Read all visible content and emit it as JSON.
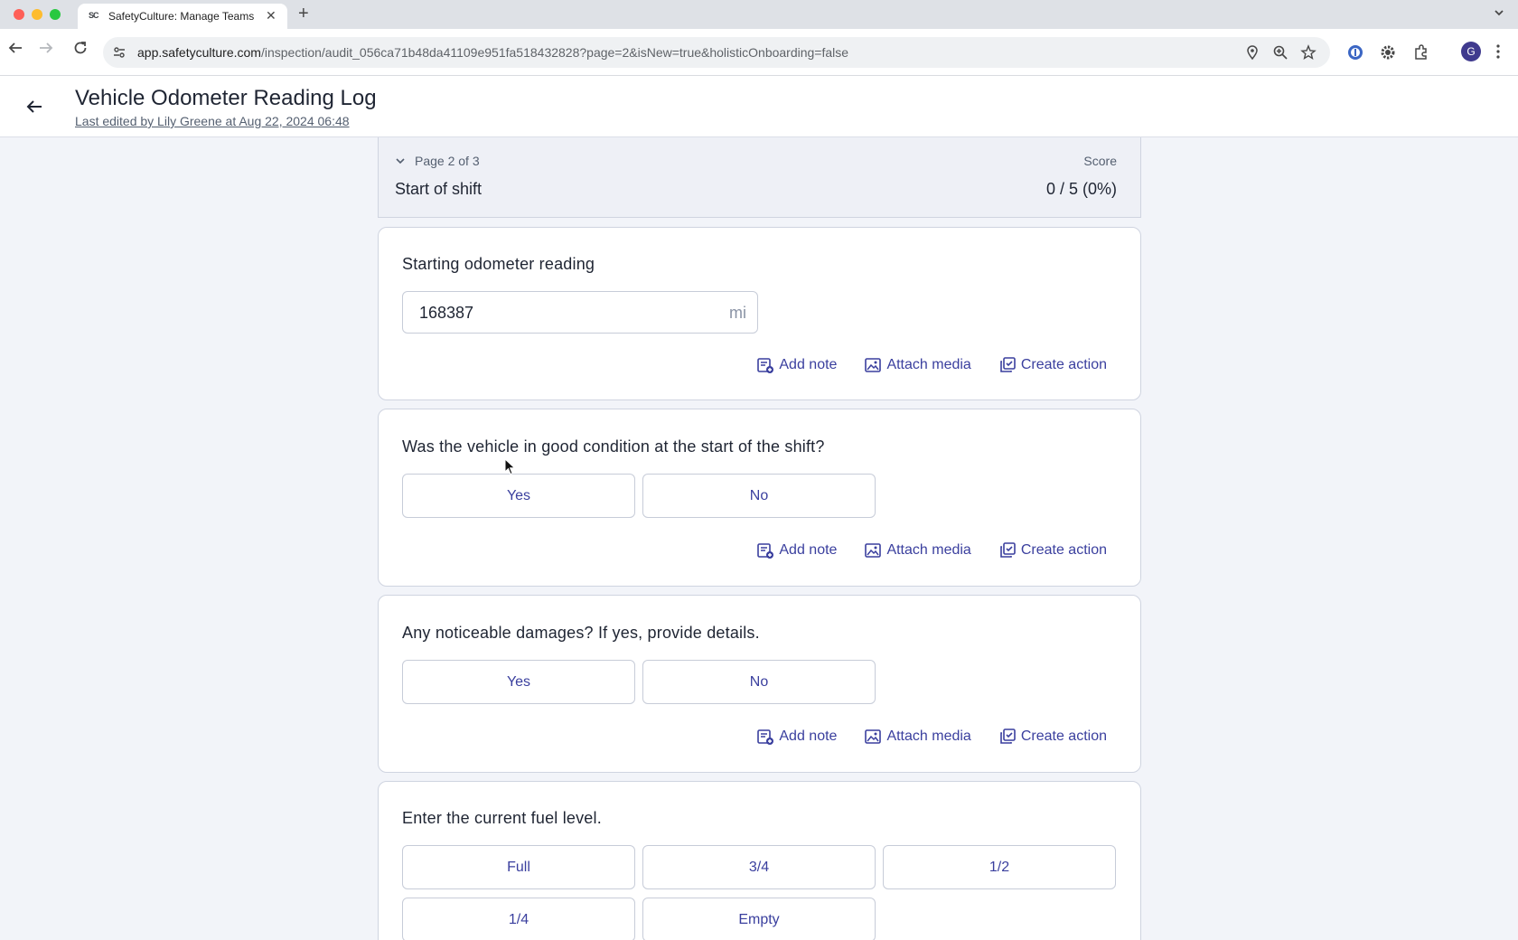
{
  "browser": {
    "tab_title": "SafetyCulture: Manage Teams",
    "tab_favicon": "SC",
    "url_host": "app.safetyculture.com",
    "url_path": "/inspection/audit_056ca71b48da41109e951fa518432828?page=2&isNew=true&holisticOnboarding=false",
    "profile_initial": "G"
  },
  "header": {
    "title": "Vehicle Odometer Reading Log",
    "last_edited": "Last edited by Lily Greene at Aug 22, 2024 06:48"
  },
  "page": {
    "label": "Page 2 of 3",
    "section": "Start of shift",
    "score_label": "Score",
    "score_value": "0 / 5 (0%)"
  },
  "questions": [
    {
      "text": "Starting odometer reading",
      "value": "168387",
      "unit": "mi"
    },
    {
      "text": "Was the vehicle in good condition at the start of the shift?",
      "options": [
        "Yes",
        "No"
      ]
    },
    {
      "text": "Any noticeable damages? If yes, provide details.",
      "options": [
        "Yes",
        "No"
      ]
    },
    {
      "text": "Enter the current fuel level.",
      "options": [
        "Full",
        "3/4",
        "1/2",
        "1/4",
        "Empty"
      ]
    }
  ],
  "actions": {
    "add_note": "Add note",
    "attach_media": "Attach media",
    "create_action": "Create action"
  },
  "colors": {
    "accent": "#3a3f9e",
    "background": "#f2f4f9",
    "card_border": "#cfd4e0"
  }
}
